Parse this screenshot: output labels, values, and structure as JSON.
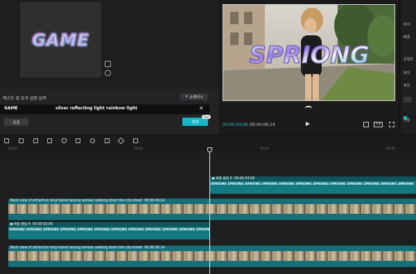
{
  "effect_panel": {
    "preview_text": "GAME",
    "settings_title": "텍스트 및 효과 설명 입력",
    "showcase_button": "쇼케이스",
    "text_value": "GAME",
    "prompt_value": "silver reflecting light rainbow light",
    "small_button": "조정",
    "generate_button": "생성",
    "generate_badge": "Pro"
  },
  "viewer": {
    "overlay_text": "SPRIONG",
    "timecode_current": "00:00:03:06",
    "timecode_total": "00:00:06:14",
    "ratio_button": "비율"
  },
  "right_panel": {
    "labels": [
      "위치",
      "배경",
      "균일한",
      "위치",
      "회전",
      "혼합"
    ]
  },
  "ruler": {
    "ticks": [
      "00:00",
      "00:02",
      "00:04",
      "00:06"
    ]
  },
  "tracks": {
    "text_clip_1": {
      "header": "복합 클립 6",
      "header_time": "00:00:03:08",
      "repeated_text": "SPRIONG SPRIONG SPRIONG SPRIONG SPRIONG SPRIONG SPRIONG SPRIONG SPRIONG SPRIONG SPRIONG SPRIONG"
    },
    "video_clip_1": {
      "label": "Back view of attractive long-haired woung woman walking down the city-street",
      "time": "00:00:06:14"
    },
    "text_clip_2": {
      "header": "복합 클립 4",
      "header_time": "00:00:03:06",
      "repeated_text": "SPRIONG SPRIONG SPRIONG SPRIONG SPRIONG SPRIONG SPRIONG SPRIONG SPRIONG SPRIONG SPRIONG SPRIONG"
    },
    "video_clip_2": {
      "label": "Back view of attractive long-haired woung woman walking down the city-street",
      "time": "00:00:06:14"
    }
  },
  "colors": {
    "accent": "#15b7c8",
    "timecode": "#2ec5d3",
    "clip_teal": "#137a83",
    "clip_header": "#0e555c"
  }
}
